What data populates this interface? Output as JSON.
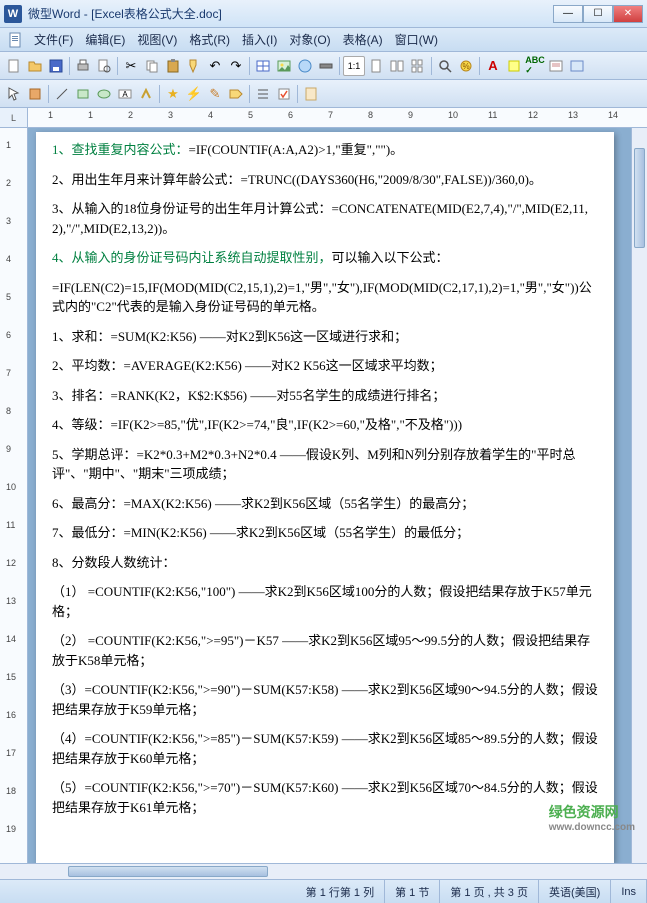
{
  "window": {
    "app_icon_letter": "W",
    "title": "微型Word - [Excel表格公式大全.doc]",
    "controls": {
      "min": "—",
      "max": "☐",
      "close": "✕"
    }
  },
  "menus": {
    "file": "文件(F)",
    "edit": "编辑(E)",
    "view": "视图(V)",
    "format": "格式(R)",
    "insert": "插入(I)",
    "object": "对象(O)",
    "table": "表格(A)",
    "window": "窗口(W)"
  },
  "ruler": {
    "corner": "L",
    "h_ticks": [
      "1",
      "1",
      "2",
      "3",
      "4",
      "5",
      "6",
      "7",
      "8",
      "9",
      "10",
      "11",
      "12",
      "13",
      "14"
    ],
    "v_ticks": [
      "1",
      "2",
      "3",
      "4",
      "5",
      "6",
      "7",
      "8",
      "9",
      "10",
      "11",
      "12",
      "13",
      "14",
      "15",
      "16",
      "17",
      "18",
      "19"
    ]
  },
  "document": {
    "paragraphs": [
      {
        "hl": "1、查找重复内容公式：",
        "rest": "=IF(COUNTIF(A:A,A2)>1,\"重复\",\"\")。"
      },
      {
        "hl": "",
        "rest": "2、用出生年月来计算年龄公式：=TRUNC((DAYS360(H6,\"2009/8/30\",FALSE))/360,0)。"
      },
      {
        "hl": "",
        "rest": "3、从输入的18位身份证号的出生年月计算公式：=CONCATENATE(MID(E2,7,4),\"/\",MID(E2,11,2),\"/\",MID(E2,13,2))。"
      },
      {
        "hl": "4、从输入的身份证号码内让系统自动提取性别，",
        "rest": "可以输入以下公式："
      },
      {
        "hl": "",
        "rest": "=IF(LEN(C2)=15,IF(MOD(MID(C2,15,1),2)=1,\"男\",\"女\"),IF(MOD(MID(C2,17,1),2)=1,\"男\",\"女\"))公式内的\"C2\"代表的是输入身份证号码的单元格。"
      },
      {
        "hl": "",
        "rest": "1、求和：=SUM(K2:K56) ——对K2到K56这一区域进行求和；"
      },
      {
        "hl": "",
        "rest": "2、平均数：=AVERAGE(K2:K56) ——对K2 K56这一区域求平均数；"
      },
      {
        "hl": "",
        "rest": "3、排名：=RANK(K2，K$2:K$56) ——对55名学生的成绩进行排名；"
      },
      {
        "hl": "",
        "rest": "4、等级：=IF(K2>=85,\"优\",IF(K2>=74,\"良\",IF(K2>=60,\"及格\",\"不及格\")))"
      },
      {
        "hl": "",
        "rest": "5、学期总评：=K2*0.3+M2*0.3+N2*0.4 ——假设K列、M列和N列分别存放着学生的\"平时总评\"、\"期中\"、\"期末\"三项成绩；"
      },
      {
        "hl": "",
        "rest": "6、最高分：=MAX(K2:K56) ——求K2到K56区域（55名学生）的最高分；"
      },
      {
        "hl": "",
        "rest": "7、最低分：=MIN(K2:K56) ——求K2到K56区域（55名学生）的最低分；"
      },
      {
        "hl": "",
        "rest": "8、分数段人数统计："
      },
      {
        "hl": "",
        "rest": "（1） =COUNTIF(K2:K56,\"100\") ——求K2到K56区域100分的人数；假设把结果存放于K57单元格；"
      },
      {
        "hl": "",
        "rest": "（2） =COUNTIF(K2:K56,\">=95\")－K57 ——求K2到K56区域95～99.5分的人数；假设把结果存放于K58单元格；"
      },
      {
        "hl": "",
        "rest": "（3）=COUNTIF(K2:K56,\">=90\")－SUM(K57:K58) ——求K2到K56区域90～94.5分的人数；假设把结果存放于K59单元格；"
      },
      {
        "hl": "",
        "rest": "（4）=COUNTIF(K2:K56,\">=85\")－SUM(K57:K59) ——求K2到K56区域85～89.5分的人数；假设把结果存放于K60单元格；"
      },
      {
        "hl": "",
        "rest": "（5）=COUNTIF(K2:K56,\">=70\")－SUM(K57:K60) ——求K2到K56区域70～84.5分的人数；假设把结果存放于K61单元格；"
      }
    ]
  },
  "status": {
    "line_col": "第 1 行第 1 列",
    "section": "第 1 节",
    "page": "第 1 页 , 共 3 页",
    "lang": "英语(美国)",
    "ins": "Ins"
  },
  "watermark": {
    "main": "绿色资源网",
    "url": "www.downcc.com"
  }
}
